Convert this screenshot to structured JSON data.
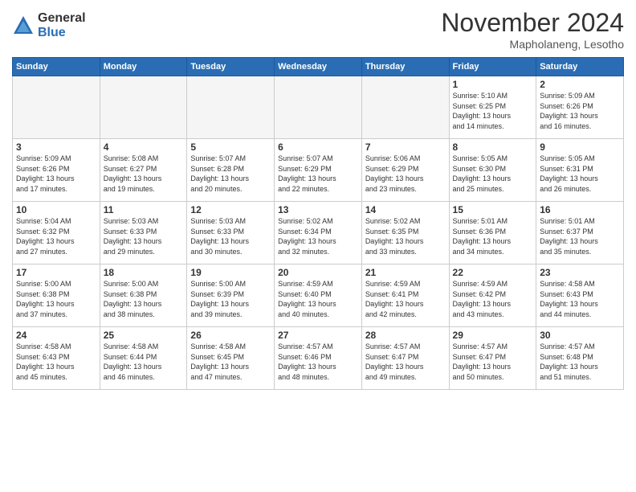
{
  "logo": {
    "general": "General",
    "blue": "Blue"
  },
  "title": "November 2024",
  "subtitle": "Mapholaneng, Lesotho",
  "days_header": [
    "Sunday",
    "Monday",
    "Tuesday",
    "Wednesday",
    "Thursday",
    "Friday",
    "Saturday"
  ],
  "weeks": [
    [
      {
        "day": "",
        "info": ""
      },
      {
        "day": "",
        "info": ""
      },
      {
        "day": "",
        "info": ""
      },
      {
        "day": "",
        "info": ""
      },
      {
        "day": "",
        "info": ""
      },
      {
        "day": "1",
        "info": "Sunrise: 5:10 AM\nSunset: 6:25 PM\nDaylight: 13 hours\nand 14 minutes."
      },
      {
        "day": "2",
        "info": "Sunrise: 5:09 AM\nSunset: 6:26 PM\nDaylight: 13 hours\nand 16 minutes."
      }
    ],
    [
      {
        "day": "3",
        "info": "Sunrise: 5:09 AM\nSunset: 6:26 PM\nDaylight: 13 hours\nand 17 minutes."
      },
      {
        "day": "4",
        "info": "Sunrise: 5:08 AM\nSunset: 6:27 PM\nDaylight: 13 hours\nand 19 minutes."
      },
      {
        "day": "5",
        "info": "Sunrise: 5:07 AM\nSunset: 6:28 PM\nDaylight: 13 hours\nand 20 minutes."
      },
      {
        "day": "6",
        "info": "Sunrise: 5:07 AM\nSunset: 6:29 PM\nDaylight: 13 hours\nand 22 minutes."
      },
      {
        "day": "7",
        "info": "Sunrise: 5:06 AM\nSunset: 6:29 PM\nDaylight: 13 hours\nand 23 minutes."
      },
      {
        "day": "8",
        "info": "Sunrise: 5:05 AM\nSunset: 6:30 PM\nDaylight: 13 hours\nand 25 minutes."
      },
      {
        "day": "9",
        "info": "Sunrise: 5:05 AM\nSunset: 6:31 PM\nDaylight: 13 hours\nand 26 minutes."
      }
    ],
    [
      {
        "day": "10",
        "info": "Sunrise: 5:04 AM\nSunset: 6:32 PM\nDaylight: 13 hours\nand 27 minutes."
      },
      {
        "day": "11",
        "info": "Sunrise: 5:03 AM\nSunset: 6:33 PM\nDaylight: 13 hours\nand 29 minutes."
      },
      {
        "day": "12",
        "info": "Sunrise: 5:03 AM\nSunset: 6:33 PM\nDaylight: 13 hours\nand 30 minutes."
      },
      {
        "day": "13",
        "info": "Sunrise: 5:02 AM\nSunset: 6:34 PM\nDaylight: 13 hours\nand 32 minutes."
      },
      {
        "day": "14",
        "info": "Sunrise: 5:02 AM\nSunset: 6:35 PM\nDaylight: 13 hours\nand 33 minutes."
      },
      {
        "day": "15",
        "info": "Sunrise: 5:01 AM\nSunset: 6:36 PM\nDaylight: 13 hours\nand 34 minutes."
      },
      {
        "day": "16",
        "info": "Sunrise: 5:01 AM\nSunset: 6:37 PM\nDaylight: 13 hours\nand 35 minutes."
      }
    ],
    [
      {
        "day": "17",
        "info": "Sunrise: 5:00 AM\nSunset: 6:38 PM\nDaylight: 13 hours\nand 37 minutes."
      },
      {
        "day": "18",
        "info": "Sunrise: 5:00 AM\nSunset: 6:38 PM\nDaylight: 13 hours\nand 38 minutes."
      },
      {
        "day": "19",
        "info": "Sunrise: 5:00 AM\nSunset: 6:39 PM\nDaylight: 13 hours\nand 39 minutes."
      },
      {
        "day": "20",
        "info": "Sunrise: 4:59 AM\nSunset: 6:40 PM\nDaylight: 13 hours\nand 40 minutes."
      },
      {
        "day": "21",
        "info": "Sunrise: 4:59 AM\nSunset: 6:41 PM\nDaylight: 13 hours\nand 42 minutes."
      },
      {
        "day": "22",
        "info": "Sunrise: 4:59 AM\nSunset: 6:42 PM\nDaylight: 13 hours\nand 43 minutes."
      },
      {
        "day": "23",
        "info": "Sunrise: 4:58 AM\nSunset: 6:43 PM\nDaylight: 13 hours\nand 44 minutes."
      }
    ],
    [
      {
        "day": "24",
        "info": "Sunrise: 4:58 AM\nSunset: 6:43 PM\nDaylight: 13 hours\nand 45 minutes."
      },
      {
        "day": "25",
        "info": "Sunrise: 4:58 AM\nSunset: 6:44 PM\nDaylight: 13 hours\nand 46 minutes."
      },
      {
        "day": "26",
        "info": "Sunrise: 4:58 AM\nSunset: 6:45 PM\nDaylight: 13 hours\nand 47 minutes."
      },
      {
        "day": "27",
        "info": "Sunrise: 4:57 AM\nSunset: 6:46 PM\nDaylight: 13 hours\nand 48 minutes."
      },
      {
        "day": "28",
        "info": "Sunrise: 4:57 AM\nSunset: 6:47 PM\nDaylight: 13 hours\nand 49 minutes."
      },
      {
        "day": "29",
        "info": "Sunrise: 4:57 AM\nSunset: 6:47 PM\nDaylight: 13 hours\nand 50 minutes."
      },
      {
        "day": "30",
        "info": "Sunrise: 4:57 AM\nSunset: 6:48 PM\nDaylight: 13 hours\nand 51 minutes."
      }
    ]
  ]
}
